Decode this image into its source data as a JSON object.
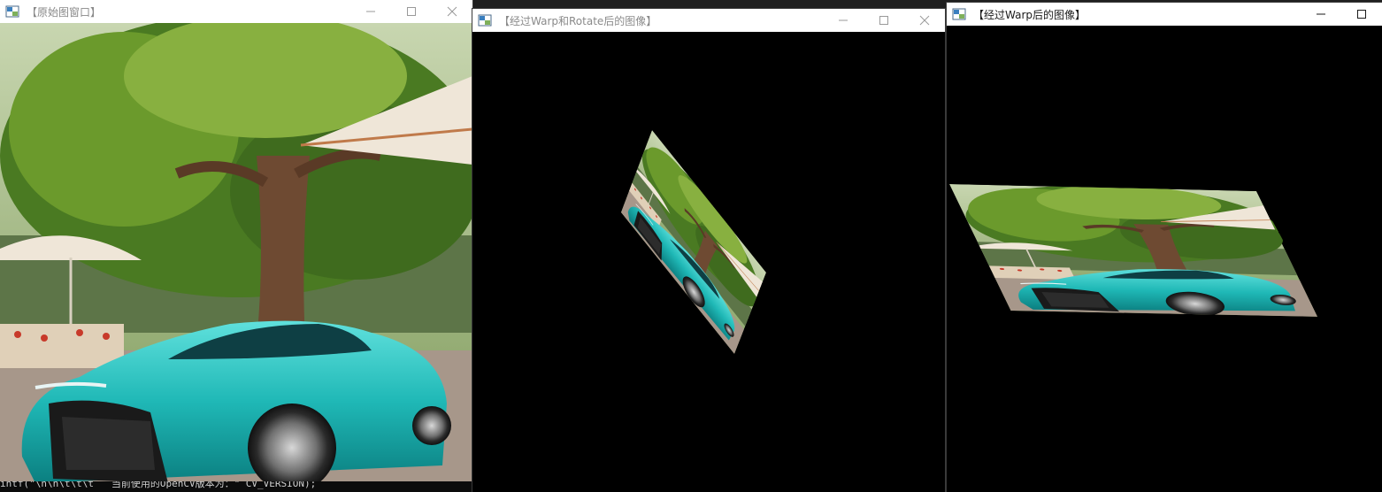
{
  "windows": [
    {
      "id": "original",
      "title": "【原始图窗口】",
      "active": false
    },
    {
      "id": "warp_rotate",
      "title": "【经过Warp和Rotate后的图像】",
      "active": false
    },
    {
      "id": "warp",
      "title": "【经过Warp后的图像】",
      "active": true
    }
  ],
  "console": {
    "line": "intf(\"\\n\\n\\t\\t\\t   当前使用的OpenCV版本为：\" CV_VERSION);"
  },
  "icons": {
    "app": "opencv-window-icon",
    "minimize": "minimize-icon",
    "maximize": "maximize-icon",
    "close": "close-icon"
  },
  "colors": {
    "titlebar": "#ffffff",
    "canvas": "#000000",
    "car_teal": "#1fb8b6",
    "foliage": "#4a7a22",
    "trunk": "#6e4a32",
    "umbrella": "#efe6d8",
    "ground": "#a7978a"
  }
}
